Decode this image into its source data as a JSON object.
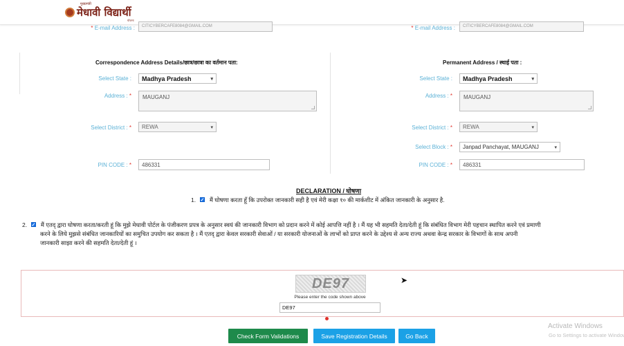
{
  "header": {
    "logo_text": "मेधावी विद्यार्थी",
    "logo_tag_top": "मुख्यमंत्री",
    "logo_tag_bottom": "योजना"
  },
  "email": {
    "label": "E-mail Address :",
    "required_mark": "*",
    "value_left": "CITICYBERCAFE8084@GMAIL.COM",
    "value_right": "CITICYBERCAFE8084@GMAIL.COM"
  },
  "correspondence": {
    "title": "Correspondence Address Details/छात्र/छात्रा का वर्तमान पता:",
    "state_label": "Select State :",
    "state_value": "Madhya Pradesh",
    "address_label": "Address :",
    "address_value": "MAUGANJ",
    "district_label": "Select District :",
    "district_value": "REWA",
    "pin_label": "PIN CODE :",
    "pin_value": "486331"
  },
  "permanent": {
    "title": "Permanent Address / स्थाई पता :",
    "state_label": "Select State :",
    "state_value": "Madhya Pradesh",
    "address_label": "Address :",
    "address_value": "MAUGANJ",
    "district_label": "Select District :",
    "district_value": "REWA",
    "block_label": "Select Block :",
    "block_value": "Janpad Panchayat, MAUGANJ",
    "pin_label": "PIN CODE :",
    "pin_value": "486331"
  },
  "declaration": {
    "title": "DECLARATION / घोषणा",
    "item1_num": "1.",
    "item1_text": "मैं घोषणा करता हूँ कि उपरोक्त जानकारी सही है एवं मेरी कक्षा १० की मार्कशीट में अंकित जानकारी के अनुसार है.",
    "item2_num": "2.",
    "item2_line1": "मैं एतद् द्वारा घोषणा करता/करती हूं कि मुझे मेधावी पोर्टल के पंजीकरण प्रपत्र के अनुसार स्वयं की जानकारी विभाग को प्रदान करने में कोई आपत्ति नहीं है । मैं यह भी सहमति देता/देती हूं कि संबंधित विभाग मेरी पहचान स्थापित करने एवं प्रमाणी",
    "item2_line2": "करने के लिये मुझसे संबंधित जानकारियों का समुचित उपयोग कर सकता है । मैं एतद् द्वारा केवल सरकारी सेवाओं / या सरकारी योजनाओं के लाभों को प्राप्त करने के उद्देश्य से अन्य राज्य अथवा केन्द्र सरकार के विभागों के साथ अपनी",
    "item2_line3": "जानकारी साझा करने की सहमति देता/देती हूं ।"
  },
  "captcha": {
    "image_text": "DE97",
    "prompt": "Please enter the code shown above",
    "value": "DE97"
  },
  "buttons": {
    "check": "Check Form Validations",
    "save": "Save Registration Details",
    "back": "Go Back"
  },
  "watermark": {
    "line1": "Activate Windows",
    "line2": "Go to Settings to activate Windows."
  },
  "colors": {
    "label_blue": "#5bb1d6",
    "required_red": "#e0312a",
    "button_green": "#1e8a4b",
    "button_blue": "#1ba1e6"
  }
}
